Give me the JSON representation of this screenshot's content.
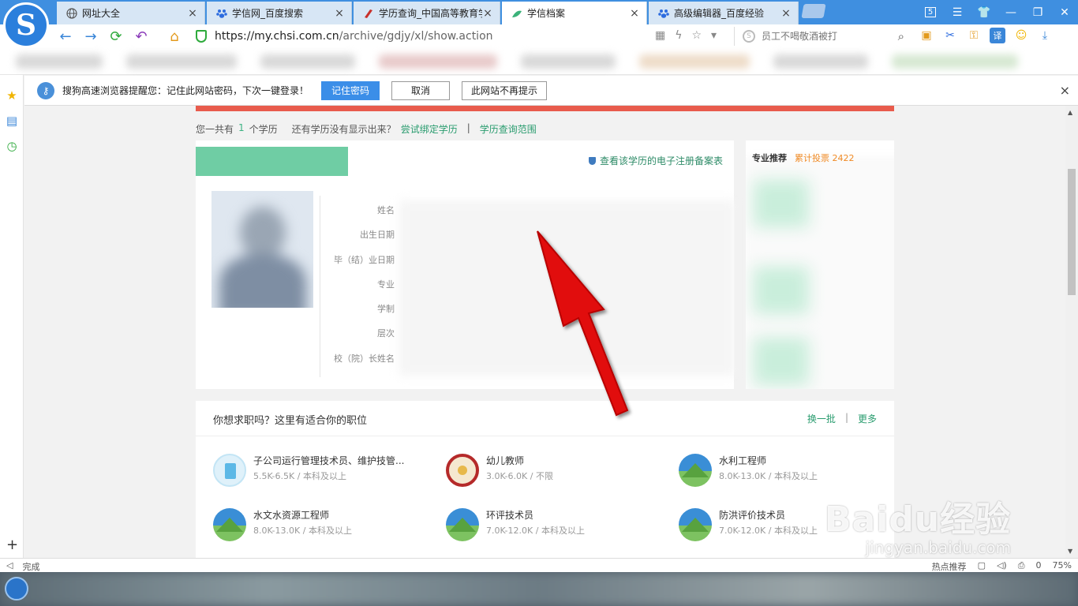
{
  "browser": {
    "tabs": [
      {
        "label": "网址大全",
        "icon": "globe-icon"
      },
      {
        "label": "学信网_百度搜索",
        "icon": "baidu-paw-icon"
      },
      {
        "label": "学历查询_中国高等教育学",
        "icon": "chsi-icon"
      },
      {
        "label": "学信档案",
        "icon": "chsi-leaf-icon",
        "active": true
      },
      {
        "label": "高级编辑器_百度经验",
        "icon": "baidu-paw-icon"
      }
    ],
    "tab_close": "×",
    "window_badge": "5",
    "url_host": "https://my.chsi.com.cn",
    "url_path": "/archive/gdjy/xl/show.action",
    "search_placeholder": "员工不喝敬酒被打",
    "colors": {
      "tab_bar": "#3f8fe0",
      "active_tab": "#ffffff",
      "secure_green": "#2eaa3c"
    }
  },
  "password_bar": {
    "message": "搜狗高速浏览器提醒您：记住此网站密码，下次一键登录！",
    "remember": "记住密码",
    "cancel": "取消",
    "never": "此网站不再提示",
    "close": "×"
  },
  "page": {
    "count_prefix": "您一共有",
    "count_value": "1",
    "count_suffix": "个学历",
    "missing_q": "还有学历没有显示出来？",
    "bind_link": "尝试绑定学历",
    "separator": "|",
    "scope_link": "学历查询范围",
    "reg_table_link": "查看该学历的电子注册备案表",
    "fields": [
      "姓名",
      "出生日期",
      "毕（结）业日期",
      "专业",
      "学制",
      "层次",
      "校（院）长姓名"
    ],
    "side_title": "专业推荐",
    "side_count": "累计投票 2422",
    "jobs_title": "你想求职吗？这里有适合你的职位",
    "refresh_link": "换一批",
    "more_link": "更多",
    "jobs": [
      {
        "name": "子公司运行管理技术员、维护技管...",
        "salary": "5.5K-6.5K",
        "edu": "本科及以上",
        "icon": "building"
      },
      {
        "name": "幼儿教师",
        "salary": "3.0K-6.0K",
        "edu": "不限",
        "icon": "kinder"
      },
      {
        "name": "水利工程师",
        "salary": "8.0K-13.0K",
        "edu": "本科及以上",
        "icon": "mountain"
      },
      {
        "name": "水文水资源工程师",
        "salary": "8.0K-13.0K",
        "edu": "本科及以上",
        "icon": "mountain"
      },
      {
        "name": "环评技术员",
        "salary": "7.0K-12.0K",
        "edu": "本科及以上",
        "icon": "mountain"
      },
      {
        "name": "防洪评价技术员",
        "salary": "7.0K-12.0K",
        "edu": "本科及以上",
        "icon": "mountain"
      }
    ],
    "job_sep": "/"
  },
  "status": {
    "left": "完成",
    "hot": "热点推荐",
    "count": "0",
    "zoom": "75%"
  },
  "watermark": {
    "brand": "Baidu经验",
    "url": "jingyan.baidu.com"
  }
}
